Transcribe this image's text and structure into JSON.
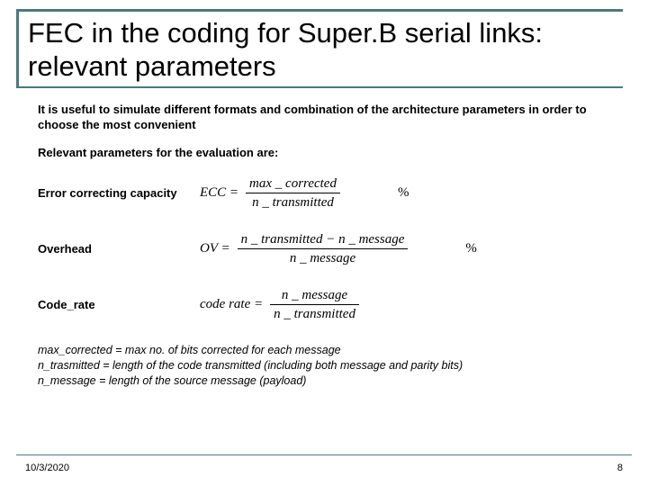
{
  "title": "FEC in the coding for Super.B serial links: relevant parameters",
  "intro": "It is useful to simulate different formats and combination of the architecture parameters in order to choose the most convenient",
  "subhead": "Relevant parameters for the evaluation are:",
  "params": {
    "ecc": {
      "label": "Error correcting capacity",
      "lhs": "ECC =",
      "num": "max _ corrected",
      "den": "n _ transmitted",
      "pct": "%"
    },
    "ov": {
      "label": "Overhead",
      "lhs": "OV =",
      "num": "n _ transmitted − n _ message",
      "den": "n _ message",
      "pct": "%"
    },
    "cr": {
      "label": "Code_rate",
      "lhs": "code rate =",
      "num": "n _ message",
      "den": "n _ transmitted",
      "pct": ""
    }
  },
  "defs": {
    "d1": "max_corrected  = max no. of bits corrected for each message",
    "d2": "n_trasmitted  = length of the code transmitted (including both message and parity bits)",
    "d3": "n_message = length of the source message (payload)"
  },
  "footer": {
    "date": "10/3/2020",
    "page": "8"
  }
}
